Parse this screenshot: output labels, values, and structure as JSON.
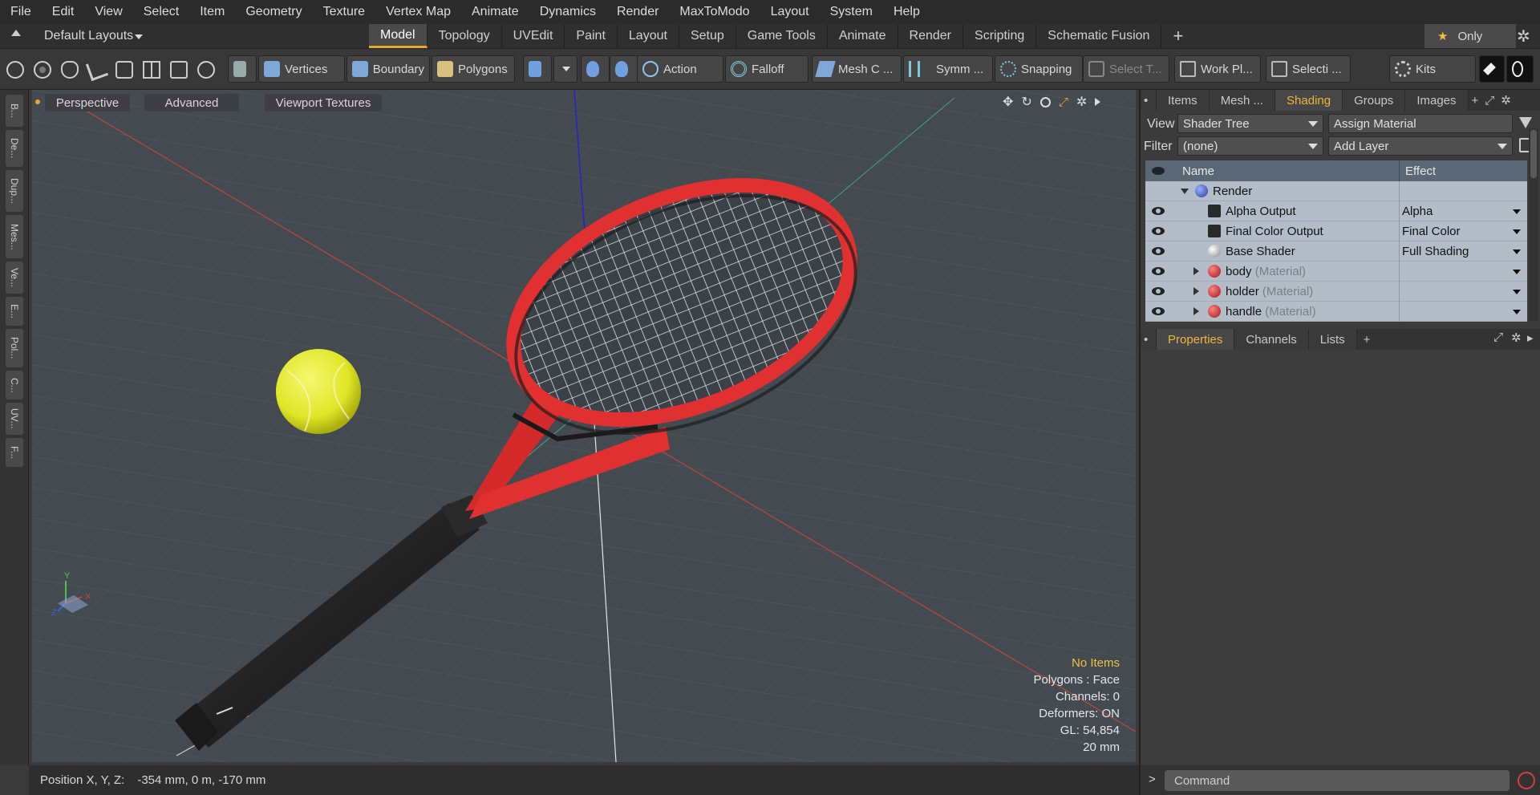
{
  "menu": [
    "File",
    "Edit",
    "View",
    "Select",
    "Item",
    "Geometry",
    "Texture",
    "Vertex Map",
    "Animate",
    "Dynamics",
    "Render",
    "MaxToModo",
    "Layout",
    "System",
    "Help"
  ],
  "layouts_label": "Default Layouts",
  "tabs": [
    "Model",
    "Topology",
    "UVEdit",
    "Paint",
    "Layout",
    "Setup",
    "Game Tools",
    "Animate",
    "Render",
    "Scripting",
    "Schematic Fusion"
  ],
  "active_tab": "Model",
  "only_label": "Only",
  "toolbar": {
    "vertices": "Vertices",
    "boundary": "Boundary",
    "polygons": "Polygons",
    "action": "Action",
    "falloff": "Falloff",
    "mesh": "Mesh C ...",
    "symm": "Symm ...",
    "snapping": "Snapping",
    "select_t": "Select T...",
    "work_plane": "Work Pl...",
    "selecti": "Selecti ...",
    "kits": "Kits"
  },
  "left_tabs": [
    "B...",
    "De...",
    "Dup...",
    "Mes...",
    "Ve...",
    "E...",
    "Pol...",
    "C...",
    "UV...",
    "F..."
  ],
  "viewport": {
    "perspective": "Perspective",
    "advanced": "Advanced",
    "textures": "Viewport Textures",
    "hud": {
      "no_items": "No Items",
      "polygons": "Polygons : Face",
      "channels": "Channels: 0",
      "deformers": "Deformers: ON",
      "gl": "GL: 54,854",
      "scale": "20 mm"
    },
    "axis_x": "X",
    "axis_y": "Y",
    "axis_z": "Z"
  },
  "status": {
    "label": "Position X, Y, Z:",
    "value": "-354 mm, 0 m, -170 mm"
  },
  "right": {
    "tabs": [
      "Items",
      "Mesh ...",
      "Shading",
      "Groups",
      "Images"
    ],
    "active_tab": "Shading",
    "view_label": "View",
    "view_value": "Shader Tree",
    "assign_material": "Assign Material",
    "filter_label": "Filter",
    "filter_value": "(none)",
    "add_layer": "Add Layer",
    "col_name": "Name",
    "col_effect": "Effect",
    "rows": [
      {
        "name": "Render",
        "suffix": "",
        "effect": ""
      },
      {
        "name": "Alpha Output",
        "suffix": "",
        "effect": "Alpha"
      },
      {
        "name": "Final Color Output",
        "suffix": "",
        "effect": "Final Color"
      },
      {
        "name": "Base Shader",
        "suffix": "",
        "effect": "Full Shading"
      },
      {
        "name": "body",
        "suffix": "(Material)",
        "effect": ""
      },
      {
        "name": "holder",
        "suffix": "(Material)",
        "effect": ""
      },
      {
        "name": "handle",
        "suffix": "(Material)",
        "effect": ""
      }
    ],
    "prop_tabs": [
      "Properties",
      "Channels",
      "Lists"
    ],
    "active_prop_tab": "Properties",
    "command_placeholder": "Command"
  },
  "colors": {
    "accent": "#e8a534",
    "racket_red": "#e03030",
    "ball_yellow": "#dfe626",
    "hud_highlight": "#f0c040"
  }
}
